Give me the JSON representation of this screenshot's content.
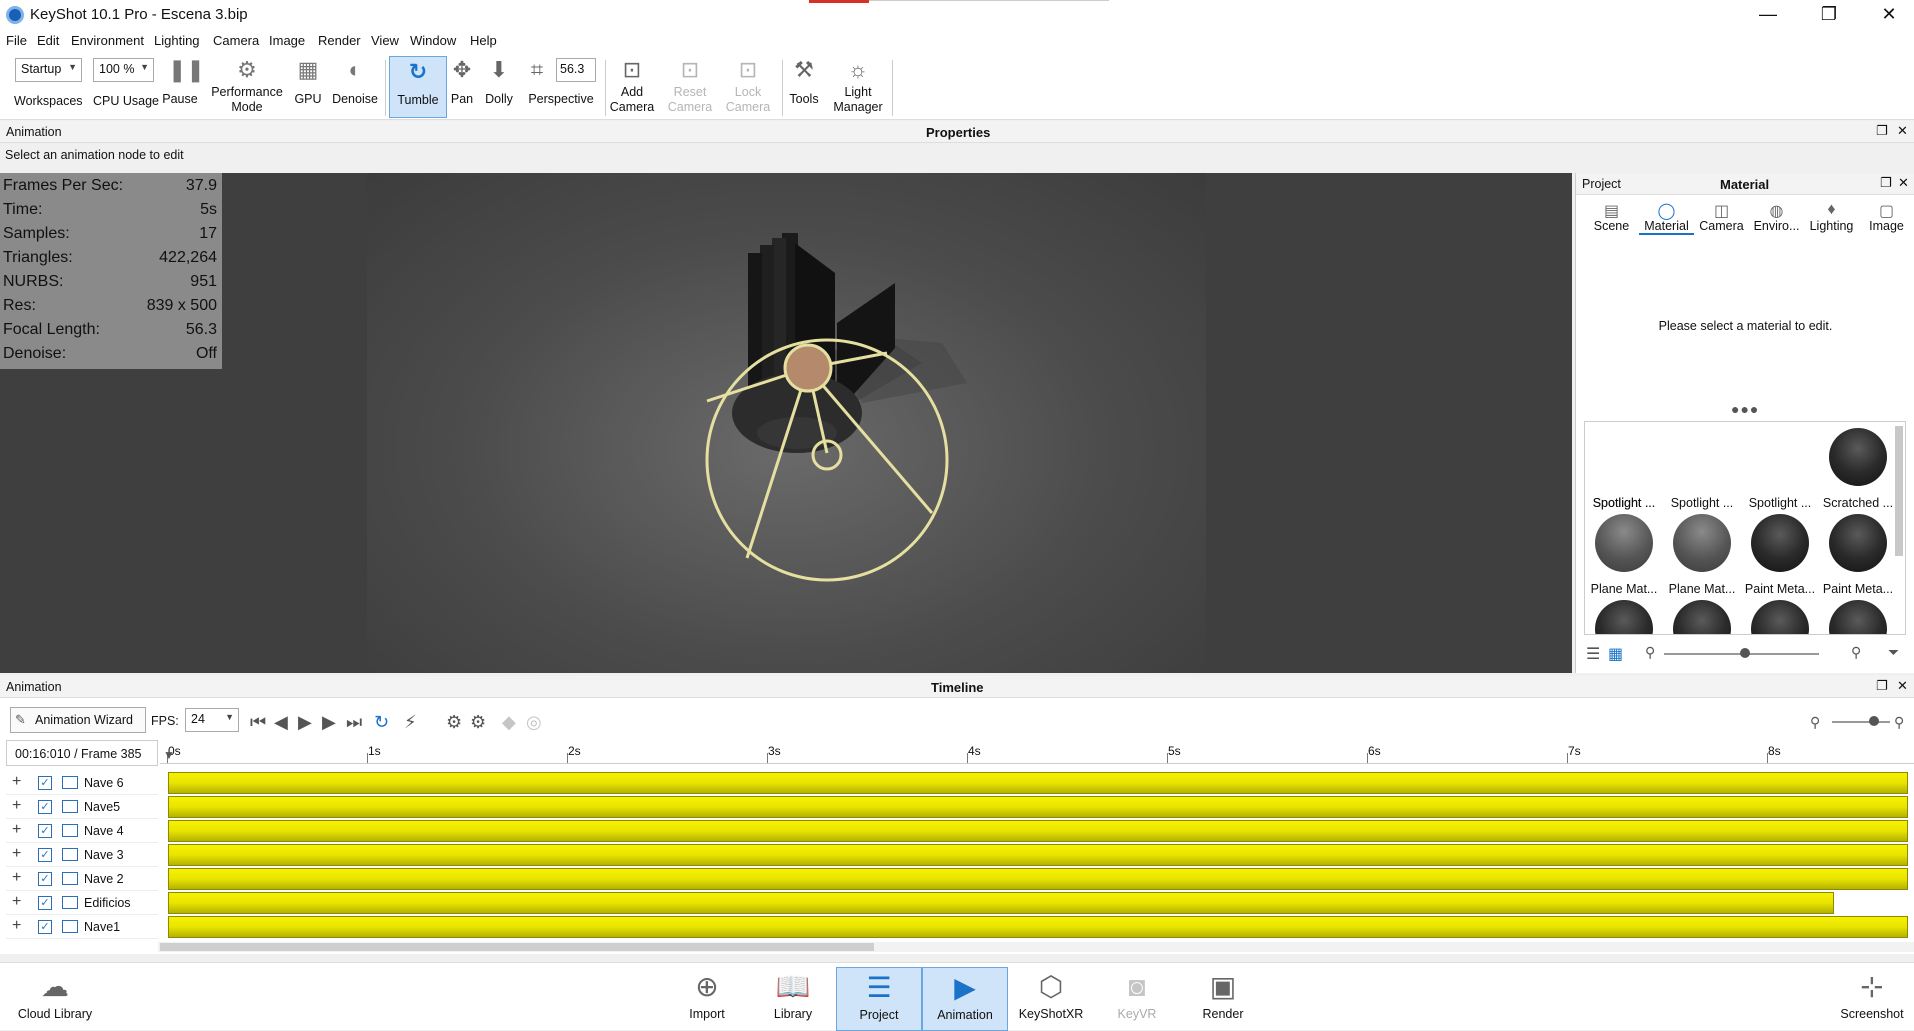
{
  "window": {
    "title": "KeyShot 10.1 Pro  - Escena 3.bip",
    "minimize": "—",
    "maximize": "❐",
    "close": "✕"
  },
  "menu": [
    "File",
    "Edit",
    "Environment",
    "Lighting",
    "Camera",
    "Image",
    "Render",
    "View",
    "Window",
    "Help"
  ],
  "toolbar": {
    "workspaces_value": "Startup",
    "workspaces_label": "Workspaces",
    "cpu_value": "100 %",
    "cpu_label": "CPU Usage",
    "pause_label": "Pause",
    "performance_label_1": "Performance",
    "performance_label_2": "Mode",
    "gpu_label": "GPU",
    "denoise_label": "Denoise",
    "tumble_label": "Tumble",
    "pan_label": "Pan",
    "dolly_label": "Dolly",
    "perspective_value": "56.3",
    "perspective_label": "Perspective",
    "add_camera_1": "Add",
    "add_camera_2": "Camera",
    "reset_camera_1": "Reset",
    "reset_camera_2": "Camera",
    "lock_camera_1": "Lock",
    "lock_camera_2": "Camera",
    "tools_label": "Tools",
    "light_manager_1": "Light",
    "light_manager_2": "Manager"
  },
  "properties_panel": {
    "left_label": "Animation",
    "title": "Properties",
    "message": "Select an animation node to edit"
  },
  "stats": [
    {
      "k": "Frames Per Sec:",
      "v": "37.9"
    },
    {
      "k": "Time:",
      "v": "5s"
    },
    {
      "k": "Samples:",
      "v": "17"
    },
    {
      "k": "Triangles:",
      "v": "422,264"
    },
    {
      "k": "NURBS:",
      "v": "951"
    },
    {
      "k": "Res:",
      "v": "839 x 500"
    },
    {
      "k": "Focal Length:",
      "v": "56.3"
    },
    {
      "k": "Denoise:",
      "v": "Off"
    }
  ],
  "project_panel": {
    "left_label": "Project",
    "title": "Material",
    "tabs": [
      {
        "label": "Scene",
        "icon": "scene-icon"
      },
      {
        "label": "Material",
        "icon": "material-icon"
      },
      {
        "label": "Camera",
        "icon": "camera-icon"
      },
      {
        "label": "Enviro...",
        "icon": "environment-icon"
      },
      {
        "label": "Lighting",
        "icon": "lighting-icon"
      },
      {
        "label": "Image",
        "icon": "image-icon"
      }
    ],
    "active_tab": "Material",
    "message": "Please select a material to edit.",
    "materials": [
      "Spotlight ...",
      "Spotlight ...",
      "Spotlight ...",
      "Scratched ...",
      "Plane Mat...",
      "Plane Mat...",
      "Paint Meta...",
      "Paint Meta..."
    ]
  },
  "timeline": {
    "left_label": "Animation",
    "title": "Timeline",
    "wizard_label": "Animation Wizard",
    "fps_label": "FPS:",
    "fps_value": "24",
    "time_readout": "00:16:010 / Frame 385",
    "ruler": [
      "0s",
      "1s",
      "2s",
      "3s",
      "4s",
      "5s",
      "6s",
      "7s",
      "8s"
    ],
    "tracks": [
      {
        "name": "Nave 6",
        "end_s": 8.7
      },
      {
        "name": "Nave5",
        "end_s": 8.7
      },
      {
        "name": "Nave 4",
        "end_s": 8.7
      },
      {
        "name": "Nave 3",
        "end_s": 8.7
      },
      {
        "name": "Nave 2",
        "end_s": 8.7
      },
      {
        "name": "Edificios",
        "end_s": 8.33
      },
      {
        "name": "Nave1",
        "end_s": 8.7
      }
    ]
  },
  "bottom": {
    "cloud_library": "Cloud Library",
    "import": "Import",
    "library": "Library",
    "project": "Project",
    "animation": "Animation",
    "keyshotxr": "KeyShotXR",
    "keyvr": "KeyVR",
    "render": "Render",
    "screenshot": "Screenshot"
  },
  "colors": {
    "accent": "#1a73c9",
    "track_yellow": "#ebe600",
    "selection": "#cfe4f8"
  }
}
